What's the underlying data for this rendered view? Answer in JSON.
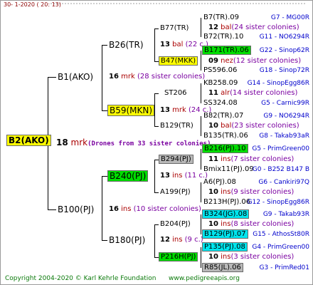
{
  "header": {
    "text": "30-   1-2020  ( 20:  13)"
  },
  "root": {
    "label": "B2(AKO)",
    "num": "18",
    "abbr": "mrk",
    "note": "(Drones from 33 sister colonies)"
  },
  "g1": {
    "top": {
      "label": "B1(AKO)",
      "num": "16",
      "abbr": "mrk",
      "note": "(28 sister colonies)"
    },
    "bottom": {
      "label": "B100(PJ)",
      "num": "16",
      "abbr": "ins",
      "note": "(10 sister colonies)"
    }
  },
  "g2": [
    {
      "label": "B26(TR)"
    },
    {
      "label": "B59(MKN)",
      "num": "13",
      "abbr": "mrk",
      "note": "(24 c.)"
    },
    {
      "label": "B240(PJ)",
      "num": "13",
      "abbr": "ins",
      "note": "(11 c.)"
    },
    {
      "label": "B180(PJ)",
      "num": "12",
      "abbr": "ins",
      "note": "(9 c.)"
    }
  ],
  "g3": [
    {
      "label": "B77(TR)"
    },
    {
      "label": "B47(MKK)",
      "num": "13",
      "abbr": "bal",
      "note": "(22 c.)"
    },
    {
      "label": "ST206"
    },
    {
      "label": "B129(TR)"
    },
    {
      "label": "B294(PJ)"
    },
    {
      "label": "A199(PJ)"
    },
    {
      "label": "B204(PJ)"
    },
    {
      "label": "P216H(PJ)"
    }
  ],
  "g4": [
    {
      "label": "B7(TR).09",
      "ref": "G7 - MG00R"
    },
    {
      "num": "12",
      "abbr": "bal",
      "note": "(24 sister colonies)"
    },
    {
      "label": "B72(TR).10",
      "ref": "G11 - NO6294R"
    },
    {
      "label": "B171(TR).06",
      "ref": "G22 - Sinop62R"
    },
    {
      "num": "09",
      "abbr": "nez",
      "note": "(12 sister colonies)"
    },
    {
      "label": "PS596.06",
      "ref": "G18 - Sinop72R"
    },
    {
      "label": "KB258.09",
      "ref": "G14 - SinopEgg86R"
    },
    {
      "num": "11",
      "abbr": "alr",
      "note": "(14 sister colonies)"
    },
    {
      "label": "SS324.08",
      "ref": "G5 - Carnic99R"
    },
    {
      "label": "B82(TR).07",
      "ref": "G9 - NO6294R"
    },
    {
      "num": "10",
      "abbr": "bal",
      "note": "(23 sister colonies)"
    },
    {
      "label": "B135(TR).06",
      "ref": "G8 - Takab93aR"
    },
    {
      "label": "B216(PJ).10",
      "ref": "G5 - PrimGreen00"
    },
    {
      "num": "11",
      "abbr": "ins",
      "note": "(7 sister colonies)"
    },
    {
      "label": "Bmix11(PJ).09",
      "ref": "G0 - B252 B147 B"
    },
    {
      "label": "A6(PJ).08",
      "ref": "G6 - Cankiri97Q"
    },
    {
      "num": "10",
      "abbr": "ins",
      "note": "(9 sister colonies)"
    },
    {
      "label": "B213H(PJ).06",
      "ref": "G12 - SinopEgg86R"
    },
    {
      "label": "B324(JG).08",
      "ref": "G9 - Takab93R"
    },
    {
      "num": "10",
      "abbr": "ins",
      "note": "(8 sister colonies)"
    },
    {
      "label": "B129(PJ).07",
      "ref": "G15 - AthosSt80R"
    },
    {
      "label": "P135(PJ).08",
      "ref": "G4 - PrimGreen00"
    },
    {
      "num": "10",
      "abbr": "ins",
      "note": "(3 sister colonies)"
    },
    {
      "label": "R85(JL).06",
      "ref": "G3 - PrimRed01"
    }
  ],
  "footer": {
    "copyright": "Copyright 2004-2020 © Karl Kehrle Foundation",
    "site": "www.pedigreeapis.org"
  }
}
